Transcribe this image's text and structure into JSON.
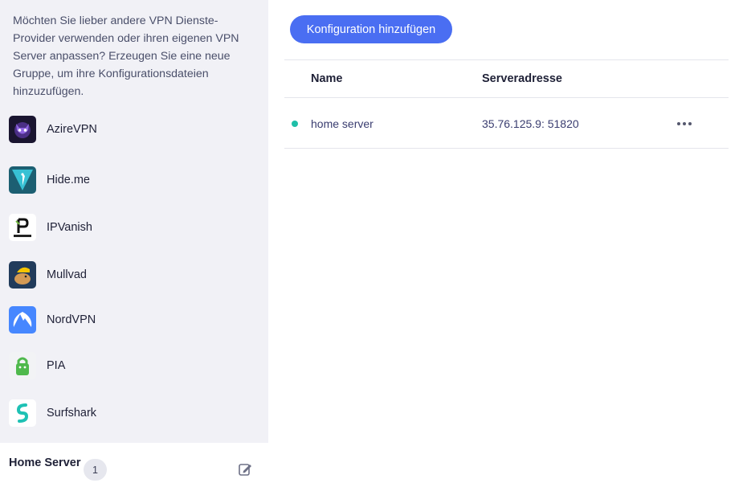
{
  "sidebar": {
    "intro": "Möchten Sie lieber andere VPN Dienste-Provider verwenden oder ihren eigenen VPN Server anpassen? Erzeugen Sie eine neue Gruppe, um ihre Konfigurationsdateien hinzuzufügen.",
    "providers": [
      {
        "name": "AzireVPN",
        "icon": "azirevpn-logo-icon"
      },
      {
        "name": "Hide.me",
        "icon": "hideme-logo-icon"
      },
      {
        "name": "IPVanish",
        "icon": "ipvanish-logo-icon"
      },
      {
        "name": "Mullvad",
        "icon": "mullvad-logo-icon"
      },
      {
        "name": "NordVPN",
        "icon": "nordvpn-logo-icon"
      },
      {
        "name": "PIA",
        "icon": "pia-logo-icon"
      },
      {
        "name": "Surfshark",
        "icon": "surfshark-logo-icon"
      }
    ],
    "group": {
      "name": "Home Server",
      "count": "1",
      "edit_icon": "edit-icon"
    }
  },
  "main": {
    "add_button": "Konfiguration hinzufügen",
    "table": {
      "headers": {
        "name": "Name",
        "address": "Serveradresse"
      },
      "rows": [
        {
          "name": "home server",
          "address": "35.76.125.9: 51820",
          "status_color": "#1fbfa8"
        }
      ]
    }
  },
  "colors": {
    "accent": "#4a6ef2",
    "sidebar_bg": "#f1f1f6",
    "status_ok": "#1fbfa8"
  }
}
